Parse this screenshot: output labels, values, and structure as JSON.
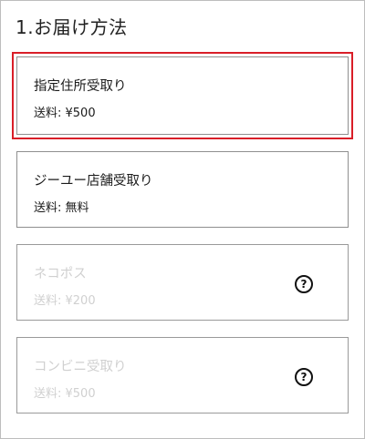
{
  "section": {
    "title": "1.お届け方法"
  },
  "options": [
    {
      "name": "指定住所受取り",
      "fee": "送料: ¥500",
      "selected": true,
      "disabled": false
    },
    {
      "name": "ジーユー店舗受取り",
      "fee": "送料: 無料",
      "selected": false,
      "disabled": false
    },
    {
      "name": "ネコポス",
      "fee": "送料: ¥200",
      "selected": false,
      "disabled": true,
      "help_icon": "question-circle-icon"
    },
    {
      "name": "コンビニ受取り",
      "fee": "送料: ¥500",
      "selected": false,
      "disabled": true,
      "help_icon": "question-circle-icon"
    }
  ],
  "colors": {
    "selected_outline": "#d91e28",
    "disabled_text": "#d0d0d0",
    "border": "#8f8f8f"
  },
  "help_glyph": "?"
}
